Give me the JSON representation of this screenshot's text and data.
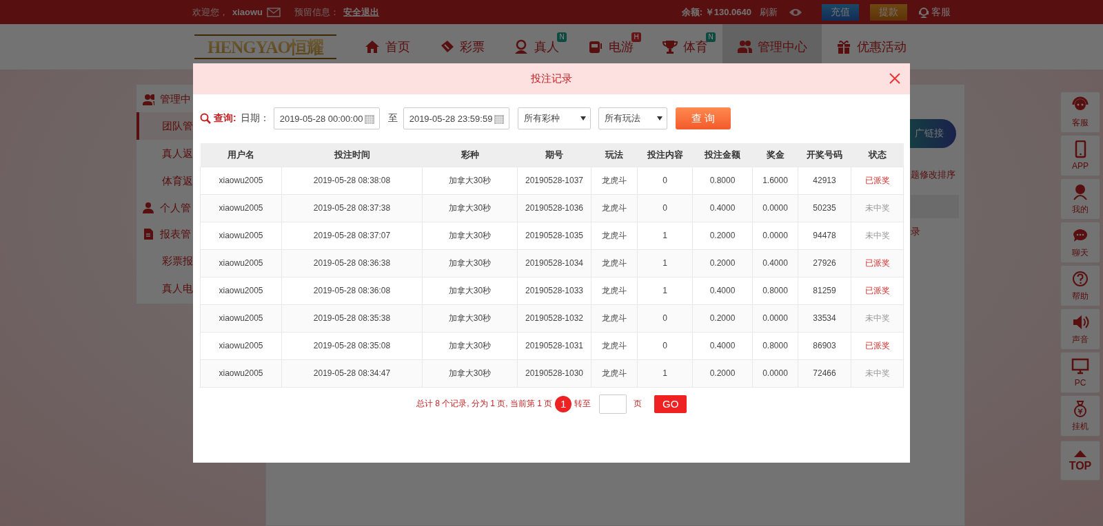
{
  "top_bar": {
    "welcome": "欢迎您，",
    "username": "xiaowu",
    "message_label": "预留信息：",
    "logout": "安全退出",
    "balance": "余额: ￥130.0640",
    "refresh": "刷新",
    "deposit": "充值",
    "withdraw": "提款",
    "service": "客服"
  },
  "nav": {
    "logo": "HENGYAO恒耀",
    "items": [
      {
        "label": "首页",
        "selected": false
      },
      {
        "label": "彩票",
        "selected": false
      },
      {
        "label": "真人",
        "badge": {
          "text": "N",
          "color": "#0e4a40"
        },
        "selected": false
      },
      {
        "label": "电游",
        "badge": {
          "text": "H",
          "color": "#661414"
        },
        "selected": false
      },
      {
        "label": "体育",
        "badge": {
          "text": "N",
          "color": "#0e4a40"
        },
        "selected": false
      },
      {
        "label": "管理中心",
        "selected": true
      },
      {
        "label": "优惠活动",
        "selected": false
      }
    ]
  },
  "sidebar": {
    "groups": [
      {
        "label": "管理中",
        "children": [
          {
            "label": "团队管",
            "selected": true
          },
          {
            "label": "真人返",
            "selected": false
          },
          {
            "label": "体育返",
            "selected": false
          }
        ]
      },
      {
        "label": "个人管"
      },
      {
        "label": "报表管",
        "children": [
          {
            "label": "彩票报",
            "selected": false
          },
          {
            "label": "真人电",
            "selected": false
          }
        ]
      }
    ]
  },
  "content": {
    "link_button": "广链接",
    "sort_hint": "题修改排序",
    "record_link": "录"
  },
  "side_toolbar": [
    "客服",
    "APP",
    "我的",
    "聊天",
    "帮助",
    "声音",
    "PC",
    "挂机",
    "TOP"
  ],
  "modal": {
    "title": "投注记录",
    "query": {
      "label": "查询:",
      "date_label": "日期：",
      "start": "2019-05-28 00:00:00",
      "to": "至",
      "end": "2019-05-28 23:59:59",
      "lottery": "所有彩种",
      "play": "所有玩法",
      "button": "查 询"
    },
    "table": {
      "columns": [
        "用户名",
        "投注时间",
        "彩种",
        "期号",
        "玩法",
        "投注内容",
        "投注金额",
        "奖金",
        "开奖号码",
        "状态"
      ],
      "rows": [
        {
          "cells": [
            "xiaowu2005",
            "2019-05-28 08:38:08",
            "加拿大30秒",
            "20190528-1037",
            "龙虎斗",
            "0",
            "0.8000",
            "1.6000",
            "42913",
            "已派奖"
          ],
          "won": true
        },
        {
          "cells": [
            "xiaowu2005",
            "2019-05-28 08:37:38",
            "加拿大30秒",
            "20190528-1036",
            "龙虎斗",
            "0",
            "0.4000",
            "0.0000",
            "50235",
            "未中奖"
          ],
          "won": false
        },
        {
          "cells": [
            "xiaowu2005",
            "2019-05-28 08:37:07",
            "加拿大30秒",
            "20190528-1035",
            "龙虎斗",
            "1",
            "0.2000",
            "0.0000",
            "94478",
            "未中奖"
          ],
          "won": false
        },
        {
          "cells": [
            "xiaowu2005",
            "2019-05-28 08:36:38",
            "加拿大30秒",
            "20190528-1034",
            "龙虎斗",
            "1",
            "0.2000",
            "0.4000",
            "27926",
            "已派奖"
          ],
          "won": true
        },
        {
          "cells": [
            "xiaowu2005",
            "2019-05-28 08:36:08",
            "加拿大30秒",
            "20190528-1033",
            "龙虎斗",
            "1",
            "0.4000",
            "0.8000",
            "81259",
            "已派奖"
          ],
          "won": true
        },
        {
          "cells": [
            "xiaowu2005",
            "2019-05-28 08:35:38",
            "加拿大30秒",
            "20190528-1032",
            "龙虎斗",
            "0",
            "0.2000",
            "0.0000",
            "33534",
            "未中奖"
          ],
          "won": false
        },
        {
          "cells": [
            "xiaowu2005",
            "2019-05-28 08:35:08",
            "加拿大30秒",
            "20190528-1031",
            "龙虎斗",
            "0",
            "0.4000",
            "0.8000",
            "86903",
            "已派奖"
          ],
          "won": true
        },
        {
          "cells": [
            "xiaowu2005",
            "2019-05-28 08:34:47",
            "加拿大30秒",
            "20190528-1030",
            "龙虎斗",
            "1",
            "0.2000",
            "0.0000",
            "72466",
            "未中奖"
          ],
          "won": false
        }
      ]
    },
    "pagination": {
      "summary": "总计 8 个记录, 分为 1 页, 当前第 1 页",
      "current": "1",
      "goto": "转至",
      "page_unit": "页",
      "go": "GO"
    }
  }
}
